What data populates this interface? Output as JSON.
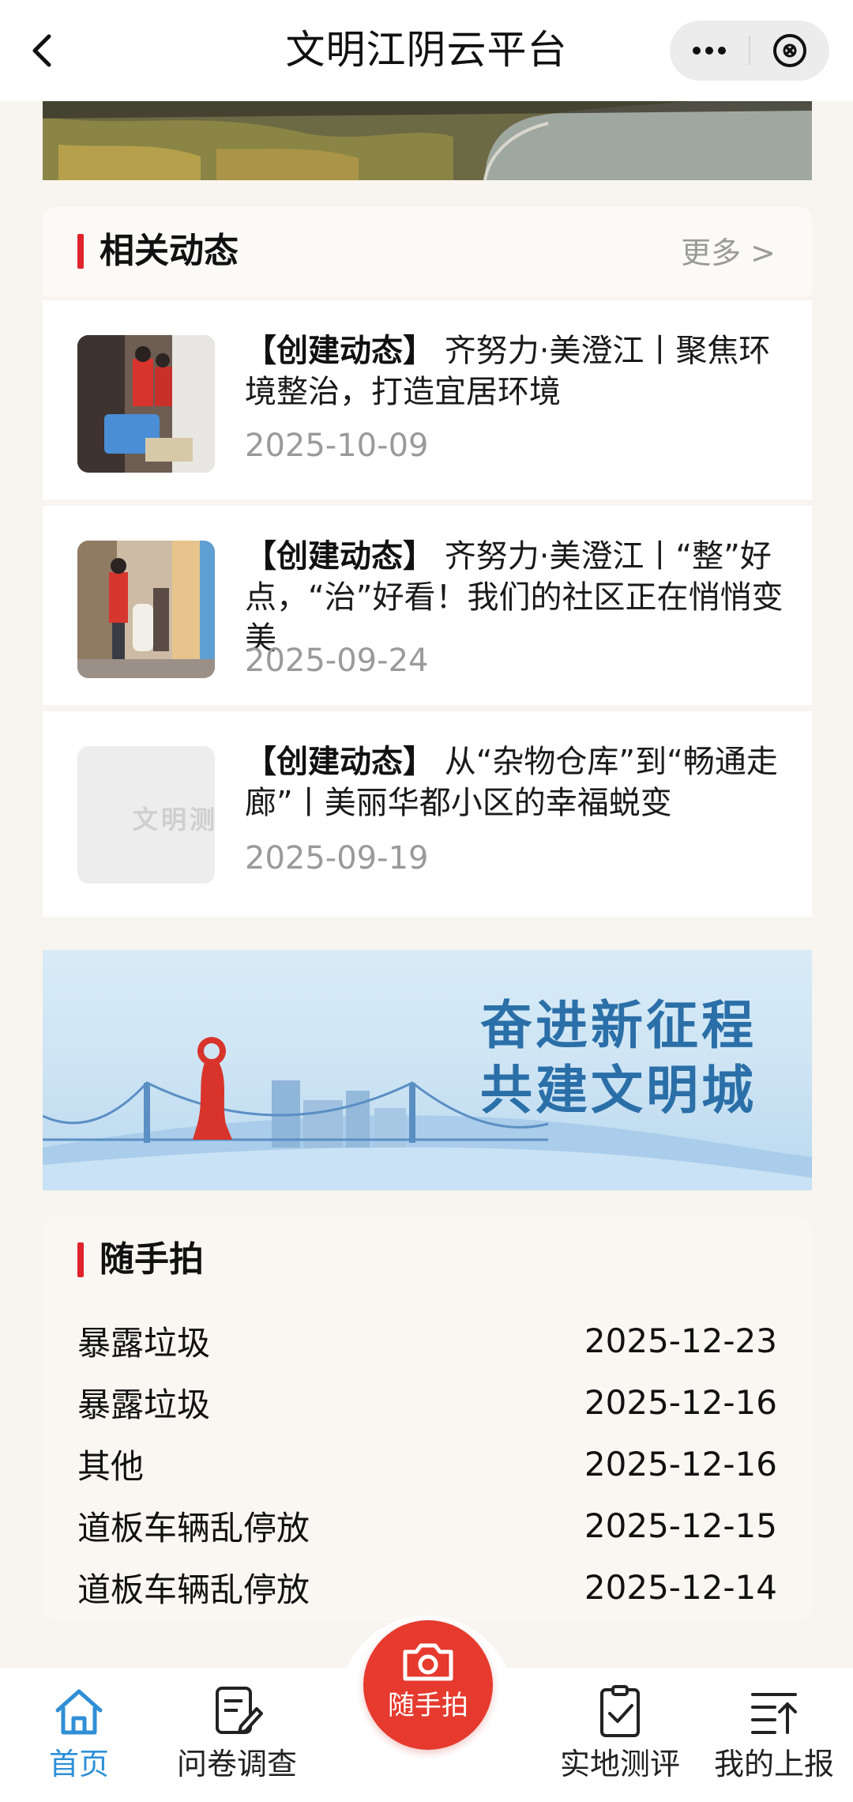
{
  "topbar": {
    "title": "文明江阴云平台"
  },
  "news": {
    "section_title": "相关动态",
    "more_label": "更多 >",
    "items": [
      {
        "tag": "【创建动态】",
        "title": " 齐努力·美澄江丨聚焦环境整治，打造宜居环境",
        "date": "2025-10-09"
      },
      {
        "tag": "【创建动态】",
        "title": " 齐努力·美澄江丨“整”好点，“治”好看！我们的社区正在悄悄变美",
        "date": "2025-09-24"
      },
      {
        "tag": "【创建动态】",
        "title": " 从“杂物仓库”到“畅通走廊”丨美丽华都小区的幸福蜕变",
        "date": "2025-09-19",
        "thumb_watermark": "文明测"
      }
    ]
  },
  "banner": {
    "line1": "奋进新征程",
    "line2": "共建文明城"
  },
  "snapshots": {
    "section_title": "随手拍",
    "items": [
      {
        "label": "暴露垃圾",
        "date": "2025-12-23"
      },
      {
        "label": "暴露垃圾",
        "date": "2025-12-16"
      },
      {
        "label": "其他",
        "date": "2025-12-16"
      },
      {
        "label": "道板车辆乱停放",
        "date": "2025-12-15"
      },
      {
        "label": "道板车辆乱停放",
        "date": "2025-12-14"
      }
    ]
  },
  "tabbar": {
    "home": "首页",
    "survey": "问卷调查",
    "camera": "随手拍",
    "evaluation": "实地测评",
    "my_reports": "我的上报"
  },
  "colors": {
    "accent_red": "#e0232b",
    "camera_red": "#e63a2f",
    "active_blue": "#2f8fd6",
    "banner_text": "#2b6fa8"
  },
  "icons": [
    "back-arrow-icon",
    "more-dots-icon",
    "close-circle-icon",
    "home-icon",
    "edit-document-icon",
    "camera-icon",
    "clipboard-check-icon",
    "sort-upload-icon"
  ]
}
